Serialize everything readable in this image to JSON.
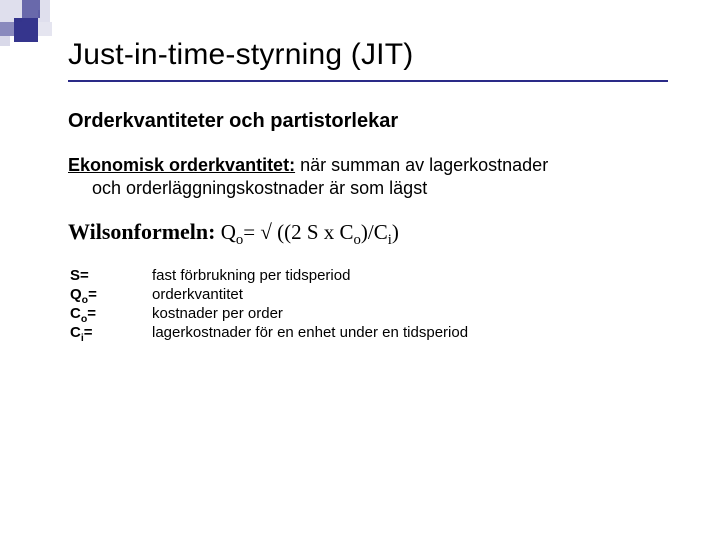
{
  "title": "Just-in-time-styrning (JIT)",
  "subtitle": "Orderkvantiteter och partistorlekar",
  "eoq": {
    "head": "Ekonomisk orderkvantitet:",
    "tail": " när summan av lagerkostnader",
    "cont": "och orderläggningskostnader är som lägst"
  },
  "wilson": {
    "head": "Wilsonformeln:",
    "body_prefix": " Q",
    "body_mid": "= √ ((2 S x C",
    "body_mid2": ")/C",
    "body_end": ")"
  },
  "defs": {
    "s_sym": "S=",
    "s_desc": "fast förbrukning per tidsperiod",
    "qo_sym_pre": "Q",
    "qo_sym_post": "=",
    "qo_desc": "orderkvantitet",
    "co_sym_pre": "C",
    "co_sym_post": "=",
    "co_desc": "kostnader per order",
    "ci_sym_pre": "C",
    "ci_sym_post": "=",
    "ci_desc": "lagerkostnader för en enhet under en tidsperiod"
  },
  "subscripts": {
    "o": "o",
    "i": "i"
  }
}
